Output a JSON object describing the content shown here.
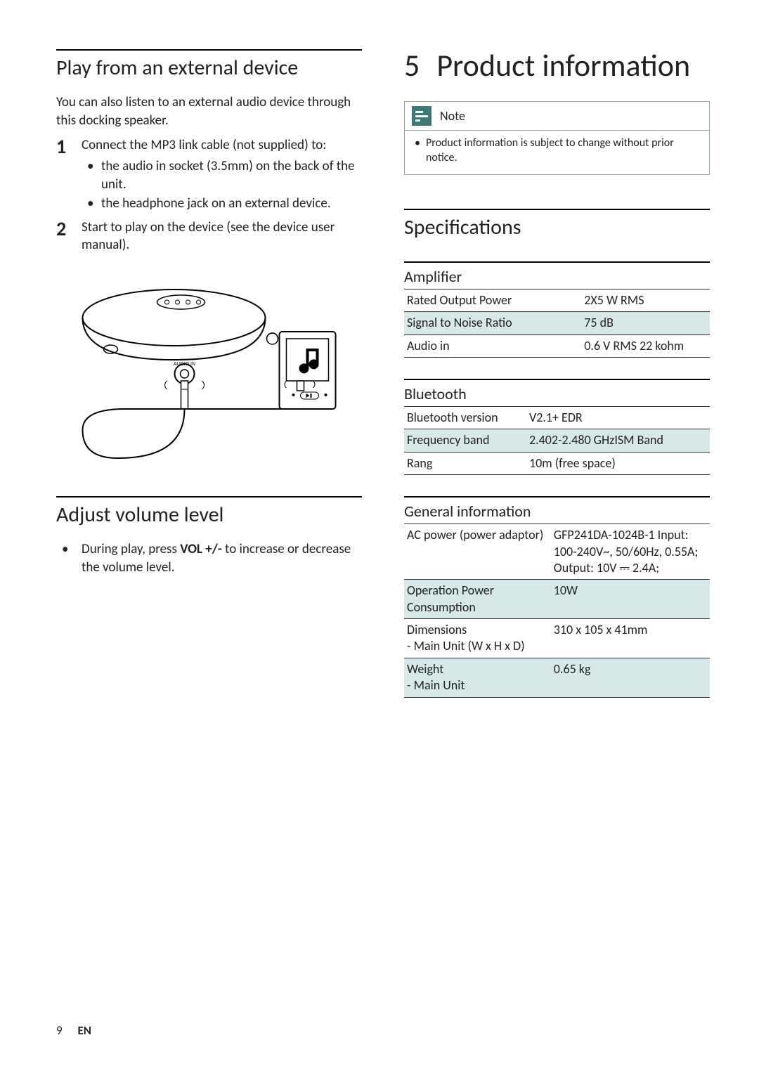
{
  "left": {
    "sec1_title": "Play from an external device",
    "intro": "You can also listen to an external audio device through this docking speaker.",
    "steps": [
      {
        "text": "Connect the MP3 link cable (not supplied) to:",
        "sub": [
          "the audio in socket (3.5mm) on the back of the unit.",
          "the headphone jack on an external device."
        ]
      },
      {
        "text": "Start to play on the device (see the device user manual).",
        "sub": []
      }
    ],
    "illustration_label": "AUDIO IN",
    "sec2_title": "Adjust volume level",
    "volume_prefix": "During play, press ",
    "volume_bold": "VOL +/-",
    "volume_suffix": " to increase or decrease the volume level."
  },
  "right": {
    "chapter_num": "5",
    "chapter_title": "Product information",
    "note_title": "Note",
    "note_text": "Product information is subject to change without prior notice.",
    "spec_title": "Specifications",
    "groups": [
      {
        "name": "Amplifier",
        "rows": [
          {
            "label": "Rated Output Power",
            "value": "2X5 W RMS",
            "zebra": false
          },
          {
            "label": "Signal to Noise Ratio",
            "value": "75 dB",
            "zebra": true
          },
          {
            "label": "Audio in",
            "value": "0.6 V RMS 22 kohm",
            "zebra": false
          }
        ],
        "label_width": "58%"
      },
      {
        "name": "Bluetooth",
        "rows": [
          {
            "label": "Bluetooth version",
            "value": "V2.1+ EDR",
            "zebra": false
          },
          {
            "label": "Frequency band",
            "value": "2.402-2.480 GHzISM Band",
            "zebra": true
          },
          {
            "label": "Rang",
            "value": "10m (free space)",
            "zebra": false
          }
        ],
        "label_width": "40%"
      },
      {
        "name": "General information",
        "rows": [
          {
            "label": "AC power (power adaptor)",
            "value": "GFP241DA-1024B-1 Input: 100-240V~, 50/60Hz, 0.55A; Output: 10V ⎓ 2.4A;",
            "zebra": false
          },
          {
            "label": "Operation Power Consumption",
            "value": "10W",
            "zebra": true
          },
          {
            "label": "Dimensions\n- Main Unit (W x H x D)",
            "value": "310 x 105 x 41mm",
            "zebra": false
          },
          {
            "label": "Weight\n - Main Unit",
            "value": "0.65 kg",
            "zebra": true
          }
        ],
        "label_width": "48%"
      }
    ]
  },
  "footer": {
    "page": "9",
    "lang": "EN"
  }
}
